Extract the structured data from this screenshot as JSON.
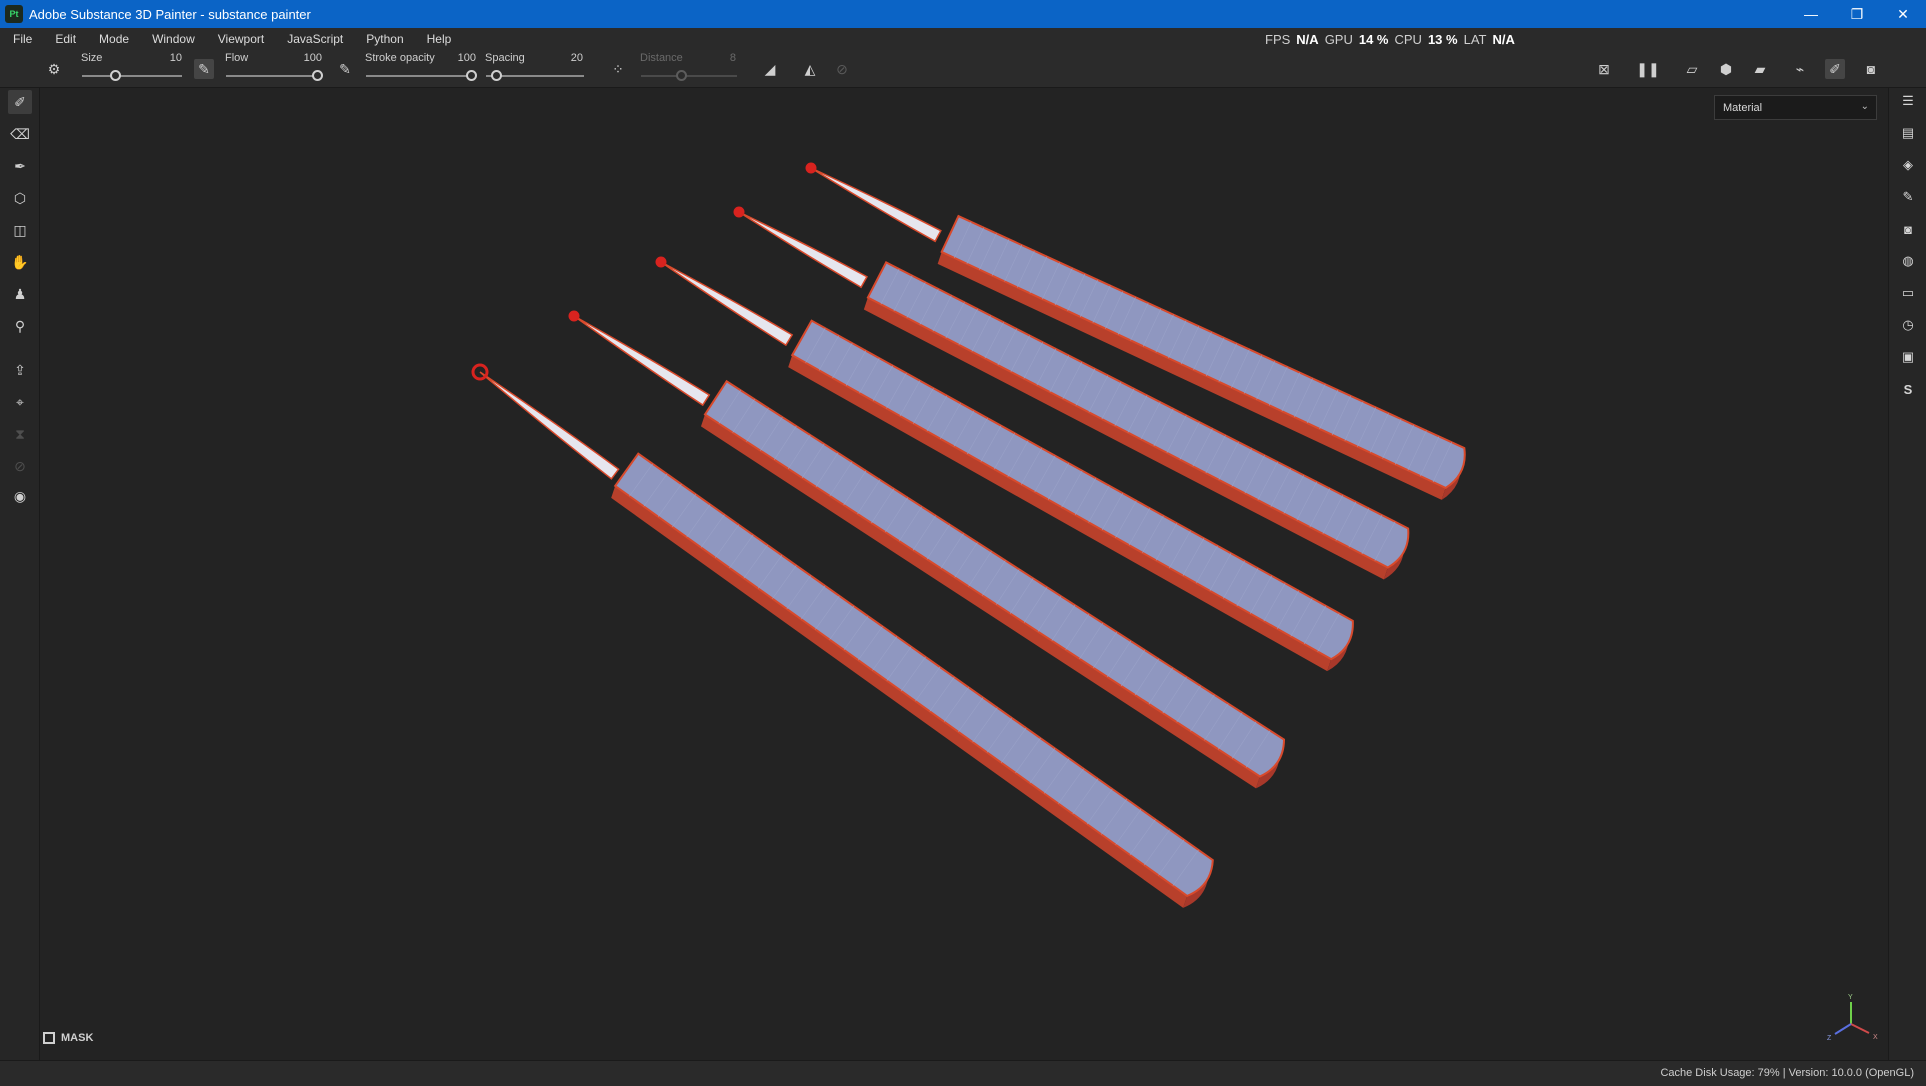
{
  "window": {
    "title": "Adobe Substance 3D Painter - substance painter",
    "app_icon_text": "Pt",
    "minimize": "—",
    "restore": "❐",
    "close": "✕"
  },
  "menu": {
    "items": [
      "File",
      "Edit",
      "Mode",
      "Window",
      "Viewport",
      "JavaScript",
      "Python",
      "Help"
    ]
  },
  "performance": {
    "fps_label": "FPS",
    "fps_value": "N/A",
    "gpu_label": "GPU",
    "gpu_value": "14 %",
    "cpu_label": "CPU",
    "cpu_value": "13 %",
    "lat_label": "LAT",
    "lat_value": "N/A"
  },
  "toolbar": {
    "size_label": "Size",
    "size_value": "10",
    "flow_label": "Flow",
    "flow_value": "100",
    "stroke_opacity_label": "Stroke opacity",
    "stroke_opacity_value": "100",
    "spacing_label": "Spacing",
    "spacing_value": "20",
    "distance_label": "Distance",
    "distance_value": "8"
  },
  "viewport": {
    "material_select": "Material",
    "mask_label": "MASK",
    "axis_labels": {
      "y": "Y",
      "z": "Z",
      "x": "X"
    }
  },
  "status": {
    "text": "Cache Disk Usage:   79% | Version: 10.0.0 (OpenGL)"
  },
  "colors": {
    "titlebar": "#0b64c6",
    "mesh_face": "#8f97c0",
    "mesh_edge": "#d84a2c",
    "tip_red": "#d8231f"
  },
  "icons": {
    "left": [
      "paint-brush-icon",
      "eraser-icon",
      "projection-icon",
      "geometry-fill-icon",
      "polygon-fill-icon",
      "smudge-icon",
      "clone-icon",
      "color-picker-icon",
      "bake-icon",
      "transform-icon",
      "mesh-icon",
      "uv-icon",
      "record-icon"
    ],
    "right": [
      "texture-set-list-icon",
      "texture-set-settings-icon",
      "layers-icon",
      "properties-icon",
      "display-settings-icon",
      "shader-settings-icon",
      "assets-icon",
      "history-icon",
      "log-icon",
      "substance-icon"
    ]
  }
}
